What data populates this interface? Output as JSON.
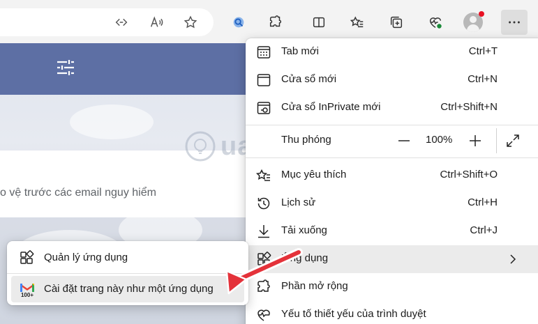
{
  "menu": {
    "items": [
      {
        "label": "Tab mới",
        "shortcut": "Ctrl+T",
        "icon": "new-tab-icon"
      },
      {
        "label": "Cửa sổ mới",
        "shortcut": "Ctrl+N",
        "icon": "new-window-icon"
      },
      {
        "label": "Cửa sổ InPrivate mới",
        "shortcut": "Ctrl+Shift+N",
        "icon": "inprivate-icon"
      },
      {
        "label": "Thu phóng",
        "icon": "zoom-icon"
      },
      {
        "label": "Mục yêu thích",
        "shortcut": "Ctrl+Shift+O",
        "icon": "favorites-icon"
      },
      {
        "label": "Lịch sử",
        "shortcut": "Ctrl+H",
        "icon": "history-icon"
      },
      {
        "label": "Tải xuống",
        "shortcut": "Ctrl+J",
        "icon": "download-icon"
      },
      {
        "label": "Ứng dụng",
        "icon": "apps-icon"
      },
      {
        "label": "Phần mở rộng",
        "icon": "extensions-icon"
      },
      {
        "label": "Yếu tố thiết yếu của trình duyệt",
        "icon": "browser-essentials-icon"
      }
    ],
    "zoom": {
      "value": "100%",
      "minus": "−",
      "plus": "+"
    }
  },
  "submenu": {
    "items": [
      {
        "label": "Quản lý ứng dụng",
        "icon": "manage-apps-icon"
      },
      {
        "label": "Cài đặt trang này như một ứng dụng",
        "icon": "gmail-icon"
      }
    ],
    "gmail_badge": "100+"
  },
  "page": {
    "panel_text": "o vệ trước các email nguy hiểm"
  },
  "watermark": {
    "text": "uantrimang"
  },
  "colors": {
    "accent": "#5d6fa4",
    "arrow": "#e4323a",
    "hover": "#ebebeb"
  }
}
